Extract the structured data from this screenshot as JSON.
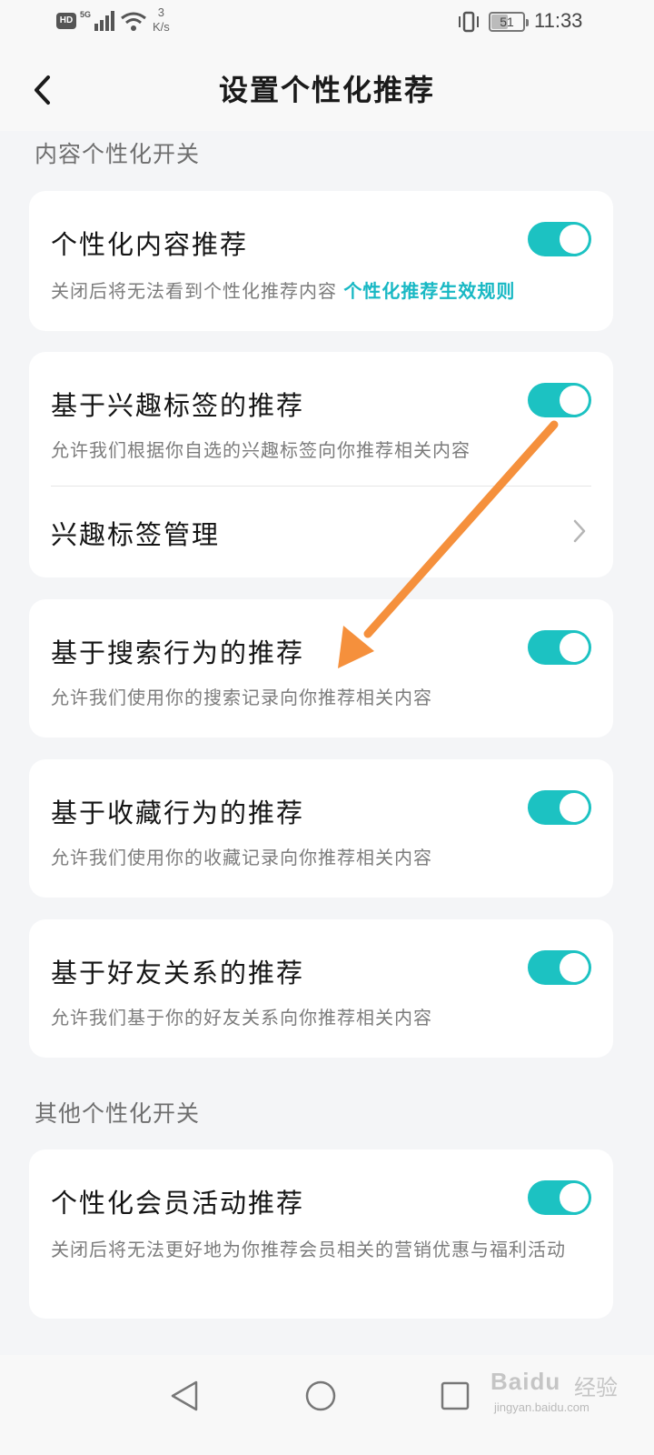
{
  "status_bar": {
    "hd": "HD",
    "network": "5G",
    "speed_value": "3",
    "speed_unit": "K/s",
    "battery": "51",
    "time": "11:33"
  },
  "header": {
    "title": "设置个性化推荐"
  },
  "sections": [
    {
      "label": "内容个性化开关",
      "cards": [
        {
          "title": "个性化内容推荐",
          "desc": "关闭后将无法看到个性化推荐内容",
          "link": "个性化推荐生效规则",
          "toggle": true
        },
        {
          "title": "基于兴趣标签的推荐",
          "desc": "允许我们根据你自选的兴趣标签向你推荐相关内容",
          "toggle": true,
          "sub_item": "兴趣标签管理"
        },
        {
          "title": "基于搜索行为的推荐",
          "desc": "允许我们使用你的搜索记录向你推荐相关内容",
          "toggle": true
        },
        {
          "title": "基于收藏行为的推荐",
          "desc": "允许我们使用你的收藏记录向你推荐相关内容",
          "toggle": true
        },
        {
          "title": "基于好友关系的推荐",
          "desc": "允许我们基于你的好友关系向你推荐相关内容",
          "toggle": true
        }
      ]
    },
    {
      "label": "其他个性化开关",
      "cards": [
        {
          "title": "个性化会员活动推荐",
          "desc": "关闭后将无法更好地为你推荐会员相关的营销优惠与福利活动",
          "toggle": true
        }
      ]
    }
  ],
  "watermark": {
    "logo": "Baidu",
    "logo_cn": "经验",
    "url": "jingyan.baidu.com"
  },
  "colors": {
    "accent": "#1cc2c2",
    "link": "#18b8c4",
    "annotation_arrow": "#f5903c",
    "background": "#f4f5f7"
  },
  "icons": {
    "back": "chevron-left-icon",
    "sub_item": "chevron-right-icon",
    "nav": [
      "back-triangle-icon",
      "home-circle-icon",
      "recents-square-icon"
    ]
  }
}
